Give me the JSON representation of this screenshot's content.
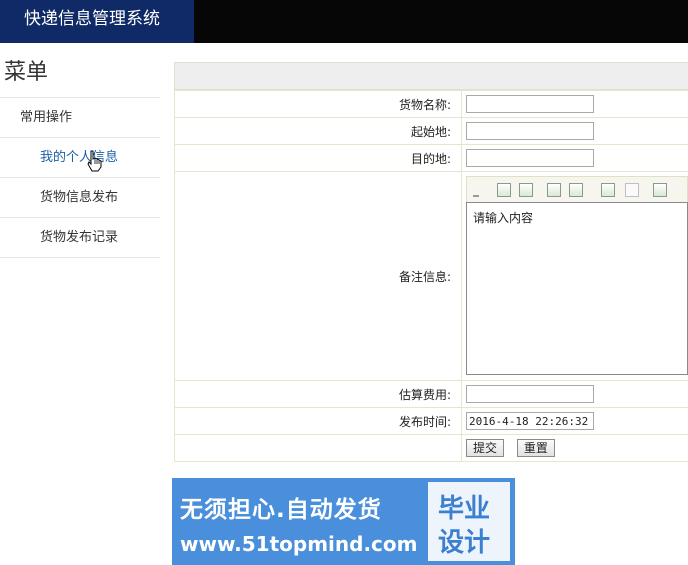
{
  "app": {
    "title": "快递信息管理系统"
  },
  "sidebar": {
    "title": "菜单",
    "group_label": "常用操作",
    "items": [
      {
        "label": "我的个人信息"
      },
      {
        "label": "货物信息发布"
      },
      {
        "label": "货物发布记录"
      }
    ]
  },
  "form": {
    "fields": {
      "name": {
        "label": "货物名称:",
        "value": ""
      },
      "origin": {
        "label": "起始地:",
        "value": ""
      },
      "destination": {
        "label": "目的地:",
        "value": ""
      },
      "remark": {
        "label": "备注信息:",
        "value": "请输入内容"
      },
      "cost": {
        "label": "估算费用:",
        "value": ""
      },
      "time": {
        "label": "发布时间:",
        "value": "2016-4-18 22:26:32"
      }
    },
    "submit_label": "提交",
    "reset_label": "重置"
  },
  "banner": {
    "main_text": "无须担心.自动发货",
    "url": "www.51topmind.com",
    "box_line1": "毕业",
    "box_line2": "设计"
  },
  "colors": {
    "brand_bg": "#0f2a66",
    "topbar_bg": "#060606",
    "active_link": "#1d5fa8",
    "banner_bg": "#4a8fdc"
  }
}
